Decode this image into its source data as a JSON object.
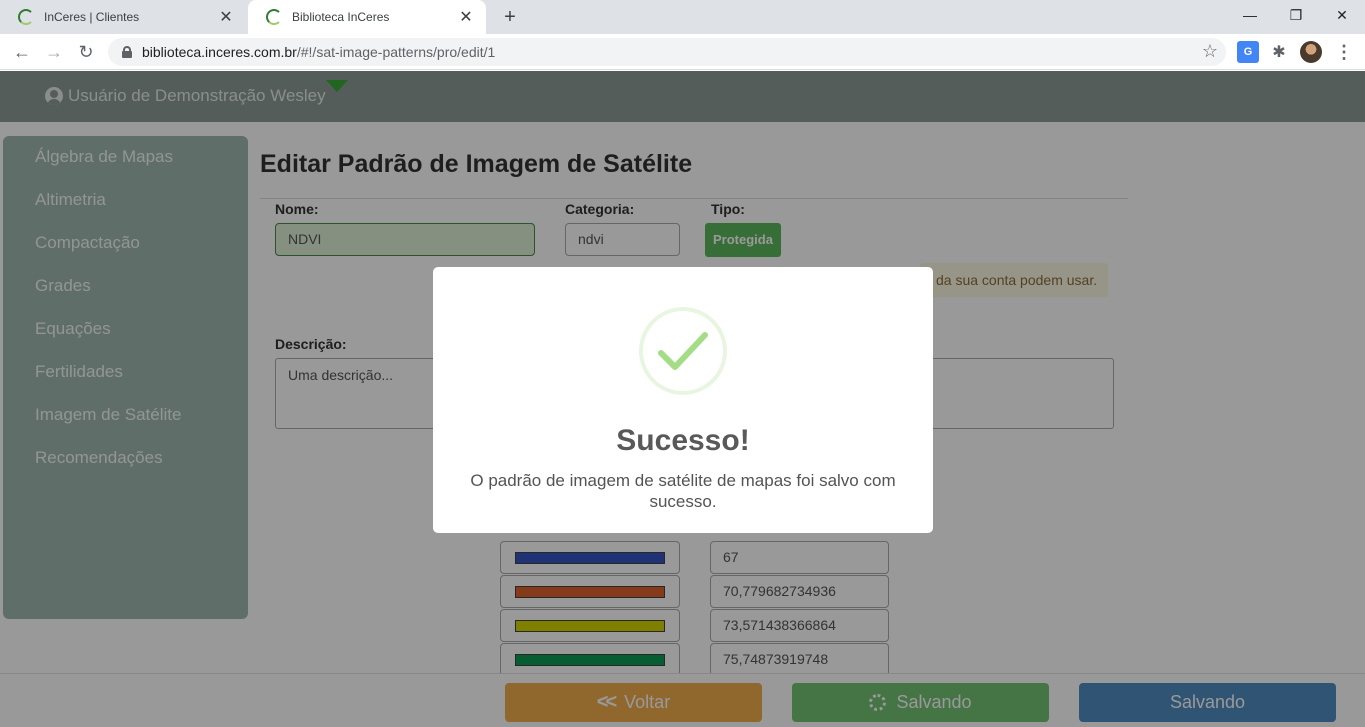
{
  "browser": {
    "tabs": [
      {
        "label": "InCeres | Clientes",
        "active": false
      },
      {
        "label": "Biblioteca InCeres",
        "active": true
      }
    ],
    "new_tab": "+",
    "minimize": "—",
    "restore": "❐",
    "close": "✕",
    "url_host": "biblioteca.inceres.com.br",
    "url_path": "/#!/sat-image-patterns/pro/edit/1"
  },
  "header": {
    "user_name": "Usuário de Demonstração Wesley"
  },
  "sidebar": {
    "items": [
      {
        "label": "Álgebra de Mapas"
      },
      {
        "label": "Altimetria"
      },
      {
        "label": "Compactação"
      },
      {
        "label": "Grades"
      },
      {
        "label": "Equações"
      },
      {
        "label": "Fertilidades"
      },
      {
        "label": "Imagem de Satélite"
      },
      {
        "label": "Recomendações"
      }
    ]
  },
  "form": {
    "title": "Editar Padrão de Imagem de Satélite",
    "name_label": "Nome:",
    "name_value": "NDVI",
    "category_label": "Categoria:",
    "category_value": "ndvi",
    "type_label": "Tipo:",
    "type_badge": "Protegida",
    "info_text": "da sua conta podem usar.",
    "description_label": "Descrição:",
    "description_placeholder": "Uma descrição...",
    "colors": [
      {
        "color": "#3454c4",
        "value": "67"
      },
      {
        "color": "#e0642c",
        "value": "70,779682734936"
      },
      {
        "color": "#d4d400",
        "value": "73,571438366864"
      },
      {
        "color": "#0c9c54",
        "value": "75,74873919748"
      }
    ]
  },
  "footer": {
    "back_label": "Voltar",
    "saving_label_green": "Salvando",
    "saving_label_blue": "Salvando"
  },
  "modal": {
    "title": "Sucesso!",
    "message": "O padrão de imagem de satélite de mapas foi salvo com sucesso."
  }
}
